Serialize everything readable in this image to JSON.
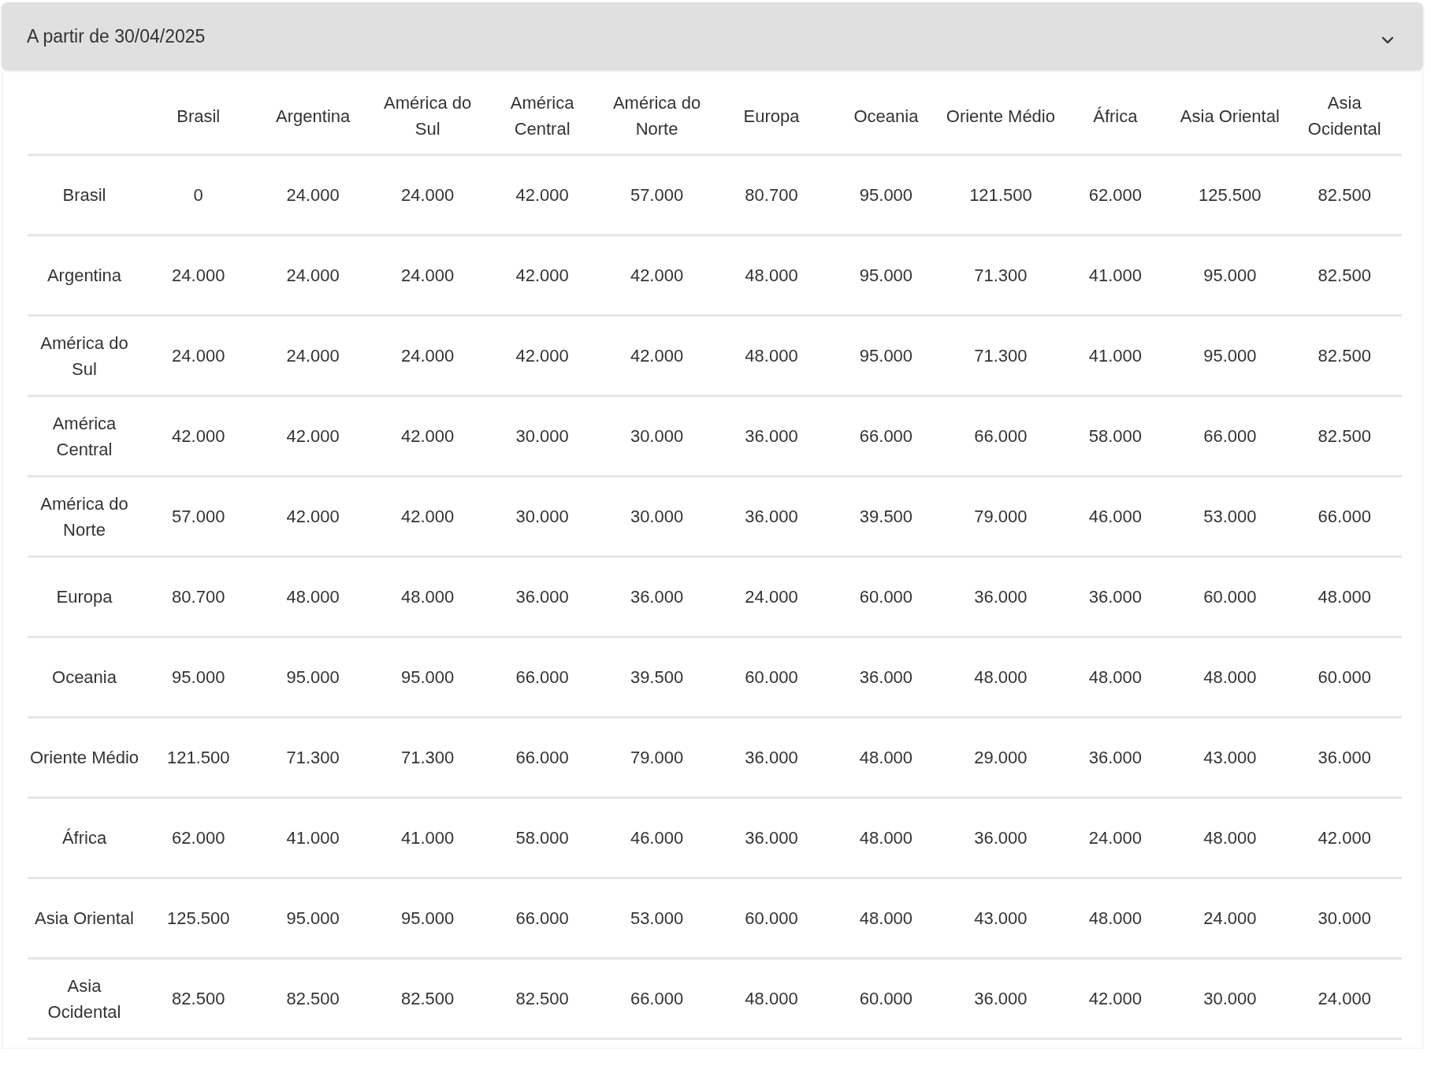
{
  "accordion": {
    "title": "A partir de 30/04/2025",
    "expanded": true
  },
  "table": {
    "columns": [
      "Brasil",
      "Argentina",
      "América do Sul",
      "América Central",
      "América do Norte",
      "Europa",
      "Oceania",
      "Oriente Médio",
      "África",
      "Asia Oriental",
      "Asia Ocidental"
    ],
    "rows": [
      {
        "label": "Brasil",
        "cells": [
          "0",
          "24.000",
          "24.000",
          "42.000",
          "57.000",
          "80.700",
          "95.000",
          "121.500",
          "62.000",
          "125.500",
          "82.500"
        ]
      },
      {
        "label": "Argentina",
        "cells": [
          "24.000",
          "24.000",
          "24.000",
          "42.000",
          "42.000",
          "48.000",
          "95.000",
          "71.300",
          "41.000",
          "95.000",
          "82.500"
        ]
      },
      {
        "label": "América do Sul",
        "cells": [
          "24.000",
          "24.000",
          "24.000",
          "42.000",
          "42.000",
          "48.000",
          "95.000",
          "71.300",
          "41.000",
          "95.000",
          "82.500"
        ]
      },
      {
        "label": "América Central",
        "cells": [
          "42.000",
          "42.000",
          "42.000",
          "30.000",
          "30.000",
          "36.000",
          "66.000",
          "66.000",
          "58.000",
          "66.000",
          "82.500"
        ]
      },
      {
        "label": "América do Norte",
        "cells": [
          "57.000",
          "42.000",
          "42.000",
          "30.000",
          "30.000",
          "36.000",
          "39.500",
          "79.000",
          "46.000",
          "53.000",
          "66.000"
        ]
      },
      {
        "label": "Europa",
        "cells": [
          "80.700",
          "48.000",
          "48.000",
          "36.000",
          "36.000",
          "24.000",
          "60.000",
          "36.000",
          "36.000",
          "60.000",
          "48.000"
        ]
      },
      {
        "label": "Oceania",
        "cells": [
          "95.000",
          "95.000",
          "95.000",
          "66.000",
          "39.500",
          "60.000",
          "36.000",
          "48.000",
          "48.000",
          "48.000",
          "60.000"
        ]
      },
      {
        "label": "Oriente Médio",
        "cells": [
          "121.500",
          "71.300",
          "71.300",
          "66.000",
          "79.000",
          "36.000",
          "48.000",
          "29.000",
          "36.000",
          "43.000",
          "36.000"
        ]
      },
      {
        "label": "África",
        "cells": [
          "62.000",
          "41.000",
          "41.000",
          "58.000",
          "46.000",
          "36.000",
          "48.000",
          "36.000",
          "24.000",
          "48.000",
          "42.000"
        ]
      },
      {
        "label": "Asia Oriental",
        "cells": [
          "125.500",
          "95.000",
          "95.000",
          "66.000",
          "53.000",
          "60.000",
          "48.000",
          "43.000",
          "48.000",
          "24.000",
          "30.000"
        ]
      },
      {
        "label": "Asia Ocidental",
        "cells": [
          "82.500",
          "82.500",
          "82.500",
          "82.500",
          "66.000",
          "48.000",
          "60.000",
          "36.000",
          "42.000",
          "30.000",
          "24.000"
        ]
      }
    ]
  }
}
